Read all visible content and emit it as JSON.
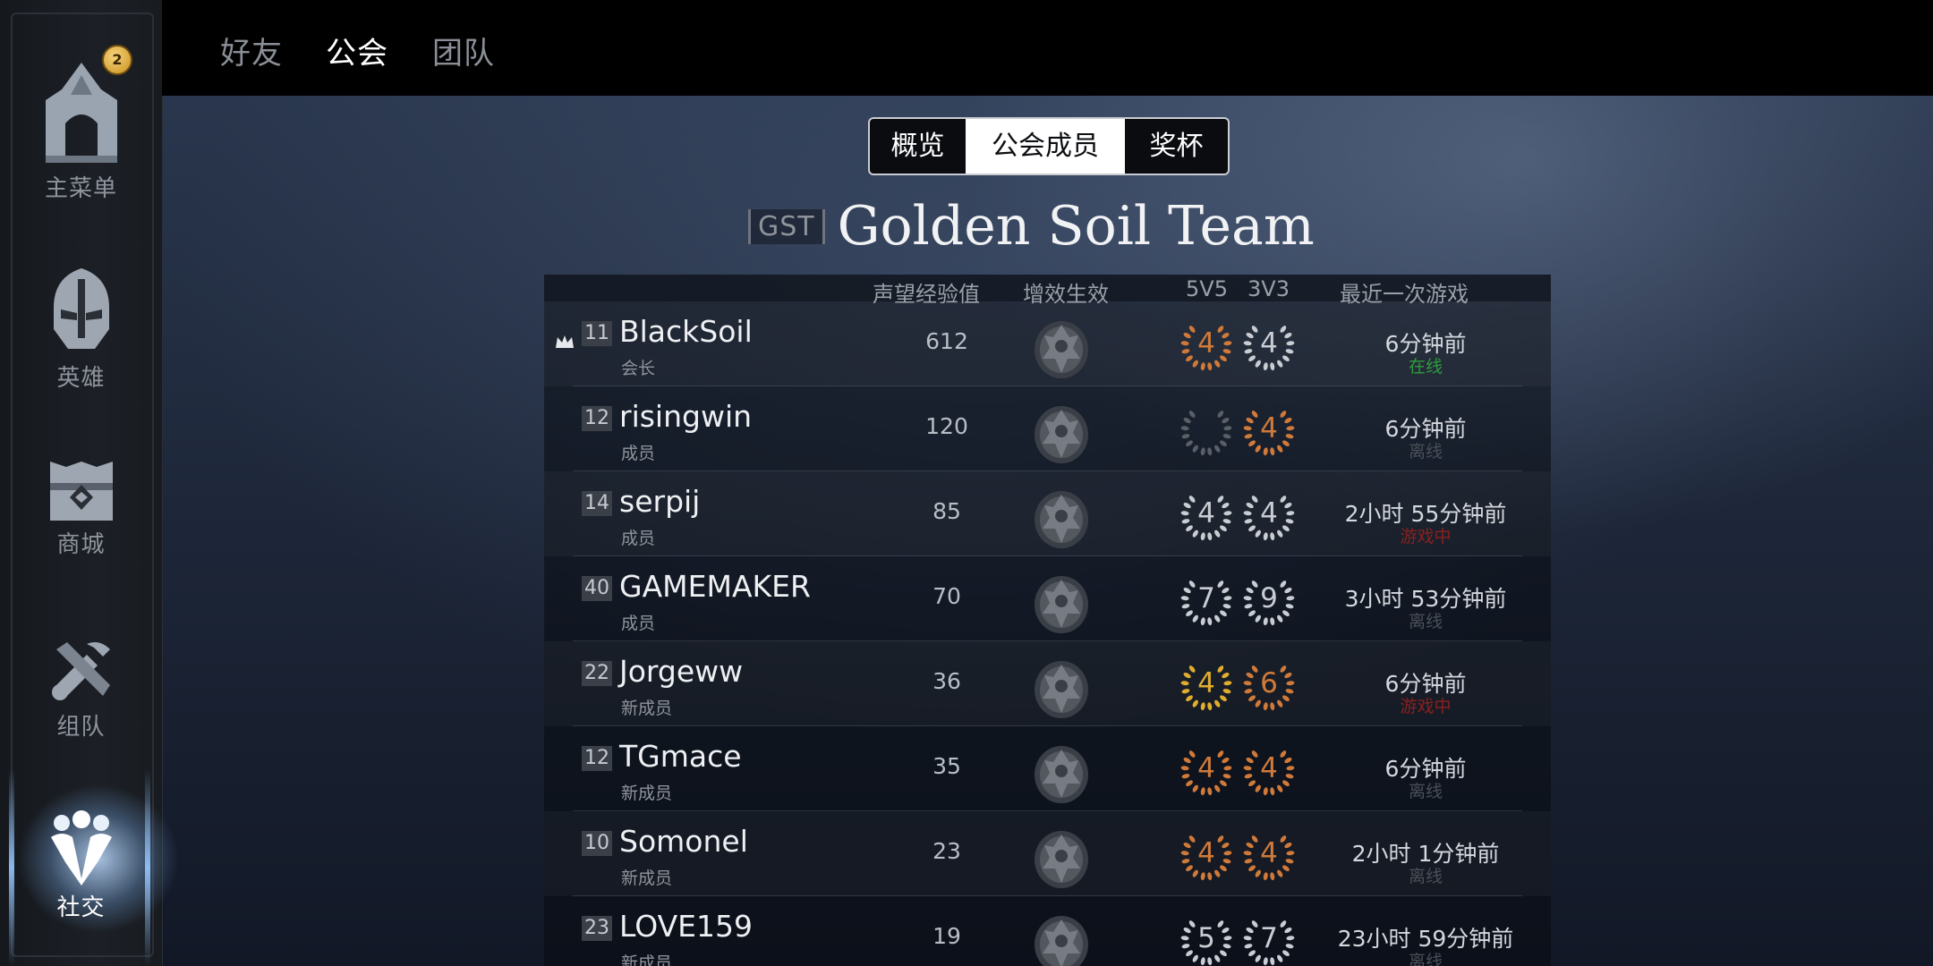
{
  "sidebar": {
    "items": [
      {
        "label": "主菜单",
        "icon": "castle-icon",
        "badge": "2"
      },
      {
        "label": "英雄",
        "icon": "helmet-icon"
      },
      {
        "label": "商城",
        "icon": "shop-icon"
      },
      {
        "label": "组队",
        "icon": "team-icon"
      },
      {
        "label": "社交",
        "icon": "social-icon",
        "active": true
      }
    ]
  },
  "topbar": {
    "tabs": [
      {
        "label": "好友"
      },
      {
        "label": "公会",
        "active": true
      },
      {
        "label": "团队"
      }
    ]
  },
  "segment": {
    "items": [
      {
        "label": "概览"
      },
      {
        "label": "公会成员",
        "active": true
      },
      {
        "label": "奖杯"
      }
    ]
  },
  "guild": {
    "tag": "GST",
    "name": "Golden Soil Team"
  },
  "table": {
    "headers": {
      "prestige": "声望经验值",
      "buff": "增效生效",
      "mode5": "5V5",
      "mode3": "3V3",
      "last": "最近一次游戏"
    },
    "rows": [
      {
        "level": "11",
        "name": "BlackSoil",
        "role": "会长",
        "prestige": "612",
        "r5": "4",
        "r5_tier": "bronze",
        "r3": "4",
        "r3_tier": "silver",
        "last": "6分钟前",
        "status": "在线",
        "status_color": "#2f9c3c",
        "leader": true
      },
      {
        "level": "12",
        "name": "risingwin",
        "role": "成员",
        "prestige": "120",
        "r5": "",
        "r5_tier": "empty",
        "r3": "4",
        "r3_tier": "bronze",
        "last": "6分钟前",
        "status": "离线",
        "status_color": "#4a4f57"
      },
      {
        "level": "14",
        "name": "serpij",
        "role": "成员",
        "prestige": "85",
        "r5": "4",
        "r5_tier": "silver",
        "r3": "4",
        "r3_tier": "silver",
        "last": "2小时 55分钟前",
        "status": "游戏中",
        "status_color": "#8a2020"
      },
      {
        "level": "40",
        "name": "GAMEMAKER",
        "role": "成员",
        "prestige": "70",
        "r5": "7",
        "r5_tier": "silver",
        "r3": "9",
        "r3_tier": "silver",
        "last": "3小时 53分钟前",
        "status": "离线",
        "status_color": "#4a4f57"
      },
      {
        "level": "22",
        "name": "Jorgeww",
        "role": "新成员",
        "prestige": "36",
        "r5": "4",
        "r5_tier": "gold",
        "r3": "6",
        "r3_tier": "bronze",
        "last": "6分钟前",
        "status": "游戏中",
        "status_color": "#8a2020"
      },
      {
        "level": "12",
        "name": "TGmace",
        "role": "新成员",
        "prestige": "35",
        "r5": "4",
        "r5_tier": "bronze",
        "r3": "4",
        "r3_tier": "bronze",
        "last": "6分钟前",
        "status": "离线",
        "status_color": "#4a4f57"
      },
      {
        "level": "10",
        "name": "Somonel",
        "role": "新成员",
        "prestige": "23",
        "r5": "4",
        "r5_tier": "bronze",
        "r3": "4",
        "r3_tier": "bronze",
        "last": "2小时 1分钟前",
        "status": "离线",
        "status_color": "#4a4f57"
      },
      {
        "level": "23",
        "name": "LOVE159",
        "role": "新成员",
        "prestige": "19",
        "r5": "5",
        "r5_tier": "silver",
        "r3": "7",
        "r3_tier": "silver",
        "last": "23小时 59分钟前",
        "status": "离线",
        "status_color": "#4a4f57"
      }
    ]
  },
  "tier_colors": {
    "bronze": "#d07a3a",
    "silver": "#c9ccd2",
    "gold": "#e0ad2e",
    "empty": "#5a5f67"
  }
}
